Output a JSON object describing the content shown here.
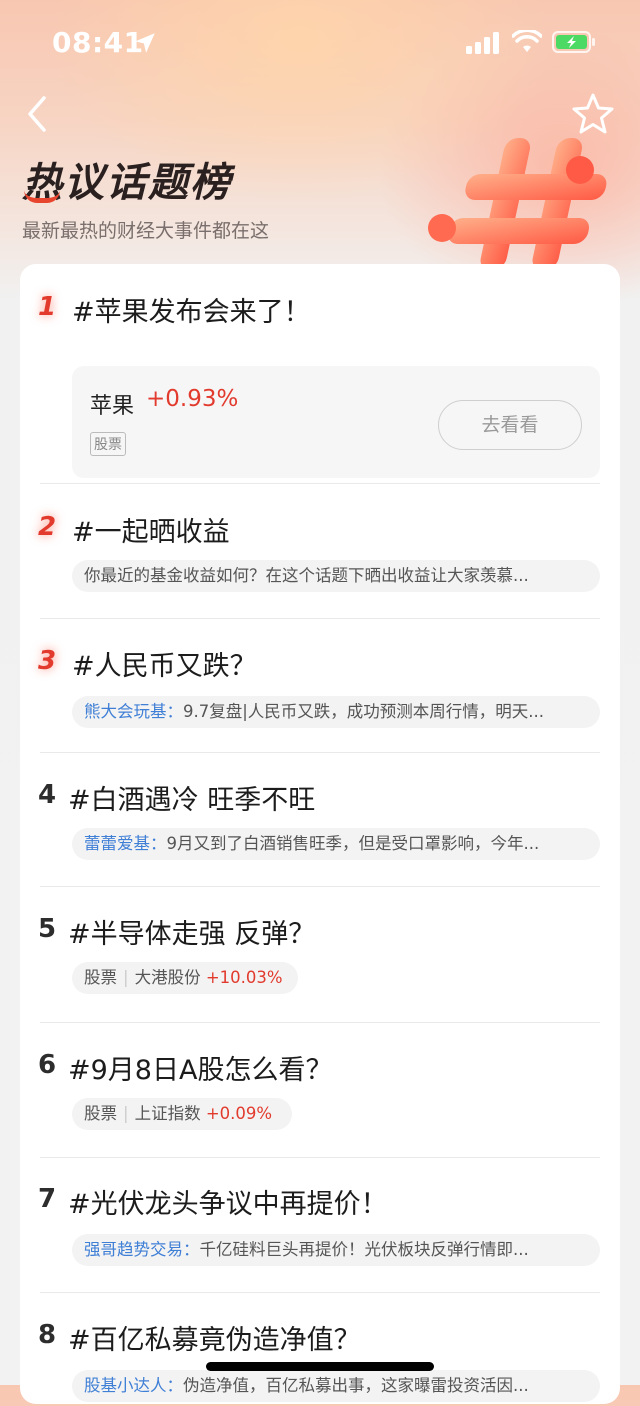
{
  "status_bar": {
    "time": "08:41"
  },
  "header": {
    "title": "热议话题榜",
    "subtitle": "最新最热的财经大事件都在这"
  },
  "topics": [
    {
      "rank": "1",
      "title": "#苹果发布会来了！",
      "stock": {
        "name": "苹果",
        "change": "+0.93%",
        "tag": "股票",
        "button": "去看看"
      }
    },
    {
      "rank": "2",
      "title": "#一起晒收益",
      "snippet": {
        "author": "",
        "text": "你最近的基金收益如何？在这个话题下晒出收益让大家羡慕..."
      }
    },
    {
      "rank": "3",
      "title": "#人民币又跌？",
      "snippet": {
        "author": "熊大会玩基：",
        "text": "9.7复盘|人民币又跌，成功预测本周行情，明天..."
      }
    },
    {
      "rank": "4",
      "title": "#白酒遇冷 旺季不旺",
      "snippet": {
        "author": "蕾蕾爱基：",
        "text": "9月又到了白酒销售旺季，但是受口罩影响，今年..."
      }
    },
    {
      "rank": "5",
      "title": "#半导体走强 反弹？",
      "quote": {
        "tag": "股票",
        "name": "大港股份",
        "change": "+10.03%"
      }
    },
    {
      "rank": "6",
      "title": "#9月8日A股怎么看？",
      "quote": {
        "tag": "股票",
        "name": "上证指数",
        "change": "+0.09%"
      }
    },
    {
      "rank": "7",
      "title": "#光伏龙头争议中再提价！",
      "snippet": {
        "author": "强哥趋势交易：",
        "text": "千亿硅料巨头再提价！光伏板块反弹行情即..."
      }
    },
    {
      "rank": "8",
      "title": "#百亿私募竟伪造净值？",
      "snippet": {
        "author": "股基小达人：",
        "text": "伪造净值，百亿私募出事，这家曝雷投资活因..."
      }
    }
  ],
  "colors": {
    "accent": "#e23b2e",
    "link": "#3f7fd6"
  }
}
